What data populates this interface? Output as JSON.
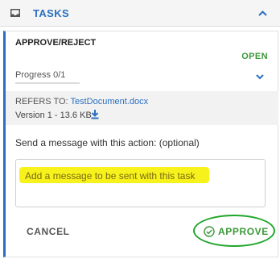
{
  "header": {
    "title": "TASKS",
    "icon": "inbox-icon",
    "collapse_icon": "chevron-up-icon"
  },
  "task": {
    "type_label": "APPROVE/REJECT",
    "status": "OPEN",
    "progress_label": "Progress 0/1",
    "progress_value": 0,
    "expand_icon": "chevron-down-icon"
  },
  "document": {
    "refers_prefix": "REFERS TO:",
    "name": "TestDocument.docx",
    "version": "Version 1 - 13.6 KB",
    "download_icon": "download-icon"
  },
  "message": {
    "label": "Send a message with this action: (optional)",
    "placeholder": "Add a message to be sent with this task",
    "value": ""
  },
  "actions": {
    "cancel_label": "CANCEL",
    "approve_label": "APPROVE",
    "approve_icon": "check-circle-icon"
  },
  "colors": {
    "accent": "#2a6fc0",
    "status_open": "#3a9a3a",
    "approve": "#3a9a3a",
    "highlight": "#f7f21c",
    "annotation_ring": "#1fa62a"
  }
}
